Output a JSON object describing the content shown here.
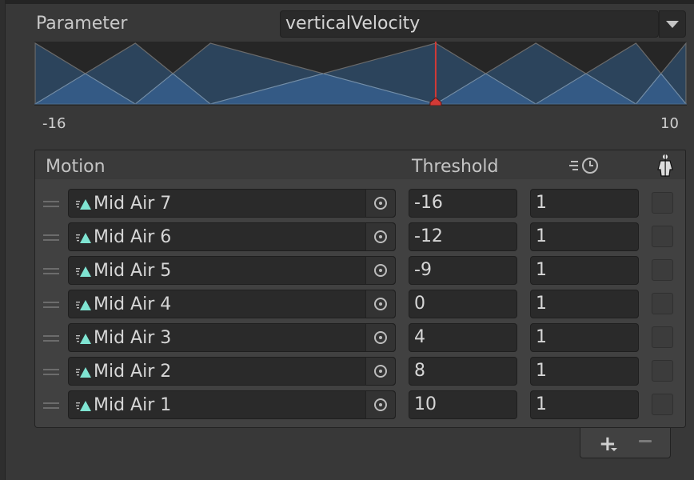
{
  "parameter": {
    "label": "Parameter",
    "value": "verticalVelocity"
  },
  "blend_graph": {
    "min_label": "-16",
    "max_label": "10",
    "range": [
      -16,
      10
    ],
    "thresholds": [
      -16,
      -12,
      -9,
      0,
      4,
      8,
      10
    ],
    "current_value": 0,
    "colors": {
      "background": "#262626",
      "active_fill": "#345a85",
      "inactive_fill": "#2e4a66",
      "edge_line": "#6f8fae",
      "marker": "#d23a36"
    }
  },
  "list": {
    "headers": {
      "motion": "Motion",
      "threshold": "Threshold",
      "speed_icon": "animation-speed-icon",
      "mirror_icon": "mirror-figure-icon"
    },
    "rows": [
      {
        "motion": "Mid Air 7",
        "threshold": "-16",
        "speed": "1",
        "mirror": false
      },
      {
        "motion": "Mid Air 6",
        "threshold": "-12",
        "speed": "1",
        "mirror": false
      },
      {
        "motion": "Mid Air 5",
        "threshold": "-9",
        "speed": "1",
        "mirror": false
      },
      {
        "motion": "Mid Air 4",
        "threshold": "0",
        "speed": "1",
        "mirror": false
      },
      {
        "motion": "Mid Air 3",
        "threshold": "4",
        "speed": "1",
        "mirror": false
      },
      {
        "motion": "Mid Air 2",
        "threshold": "8",
        "speed": "1",
        "mirror": false
      },
      {
        "motion": "Mid Air 1",
        "threshold": "10",
        "speed": "1",
        "mirror": false
      }
    ],
    "footer": {
      "add_label": "+",
      "remove_label": "−"
    }
  },
  "accent_colors": {
    "clip_icon": "#7fe4d2"
  }
}
